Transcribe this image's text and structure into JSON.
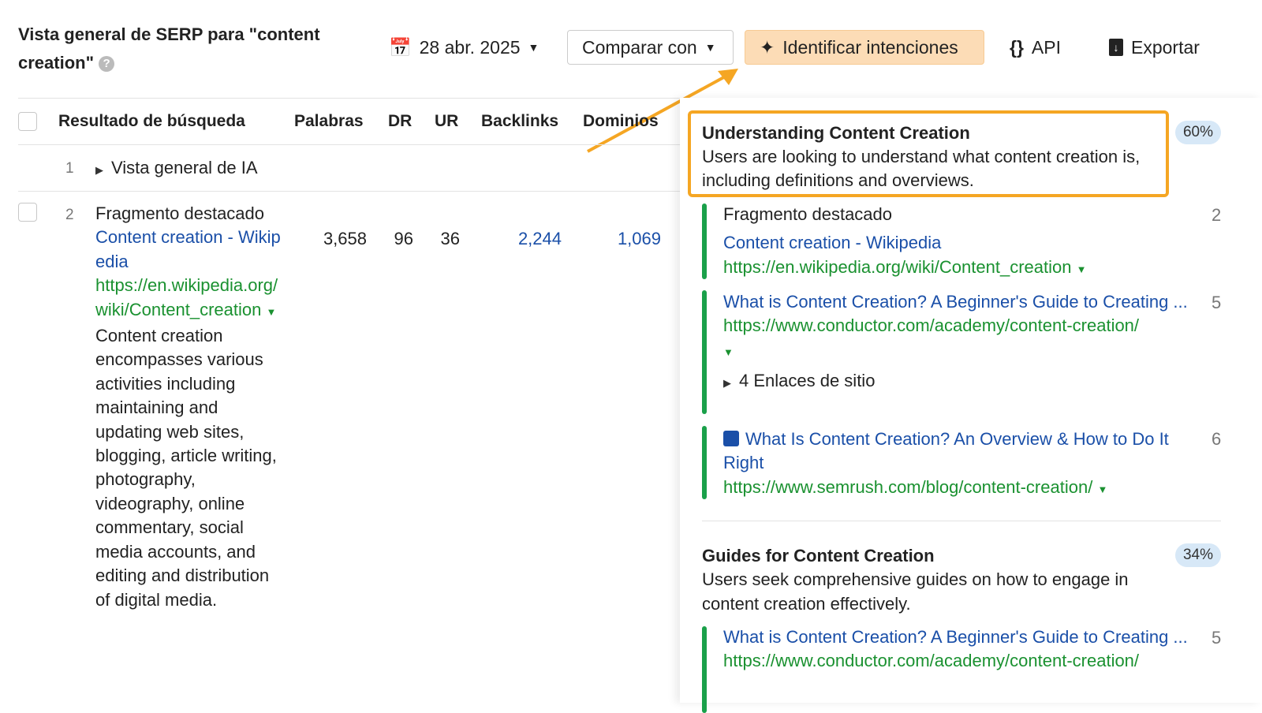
{
  "header": {
    "title": "Vista general de SERP para \"content creation\"",
    "help": "?",
    "date": "28 abr. 2025",
    "compare": "Comparar con",
    "identify": "Identificar intenciones",
    "api": "API",
    "export": "Exportar"
  },
  "table": {
    "columns": [
      "Resultado de búsqueda",
      "Palabras",
      "DR",
      "UR",
      "Backlinks",
      "Dominios"
    ],
    "rows": [
      {
        "pos": "1",
        "label": "Vista general de IA"
      },
      {
        "pos": "2",
        "type": "Fragmento destacado",
        "title": "Content creation - Wikipedia",
        "url": "https://en.wikipedia.org/wiki/Content_creation",
        "snippet": "Content creation encompasses various activities including maintaining and updating web sites, blogging, article writing, photography, videography, online commentary, social media accounts, and editing and distribution of digital media.",
        "words": "3,658",
        "dr": "96",
        "ur": "36",
        "backlinks": "2,244",
        "domains": "1,069"
      }
    ]
  },
  "intents": [
    {
      "title": "Understanding Content Creation",
      "desc": "Users are looking to understand what content creation is, including definitions and overviews.",
      "pct": "60%",
      "results": [
        {
          "type": "Fragmento destacado",
          "title": "Content creation - Wikipedia",
          "url": "https://en.wikipedia.org/wiki/Content_creation",
          "rank": "2"
        },
        {
          "title": "What is Content Creation? A Beginner's Guide to Creating ...",
          "url": "https://www.conductor.com/academy/content-creation/",
          "sitelinks": "4 Enlaces de sitio",
          "rank": "5"
        },
        {
          "title": "What Is Content Creation? An Overview & How to Do It Right",
          "url": "https://www.semrush.com/blog/content-creation/",
          "rank": "6"
        }
      ]
    },
    {
      "title": "Guides for Content Creation",
      "desc": "Users seek comprehensive guides on how to engage in content creation effectively.",
      "pct": "34%",
      "results": [
        {
          "title": "What is Content Creation? A Beginner's Guide to Creating ...",
          "url": "https://www.conductor.com/academy/content-creation/",
          "rank": "5"
        }
      ]
    }
  ],
  "colors": {
    "accent": "#f5a623",
    "link": "#1a4fa8",
    "url": "#1a9130",
    "bar": "#1aa04a"
  }
}
